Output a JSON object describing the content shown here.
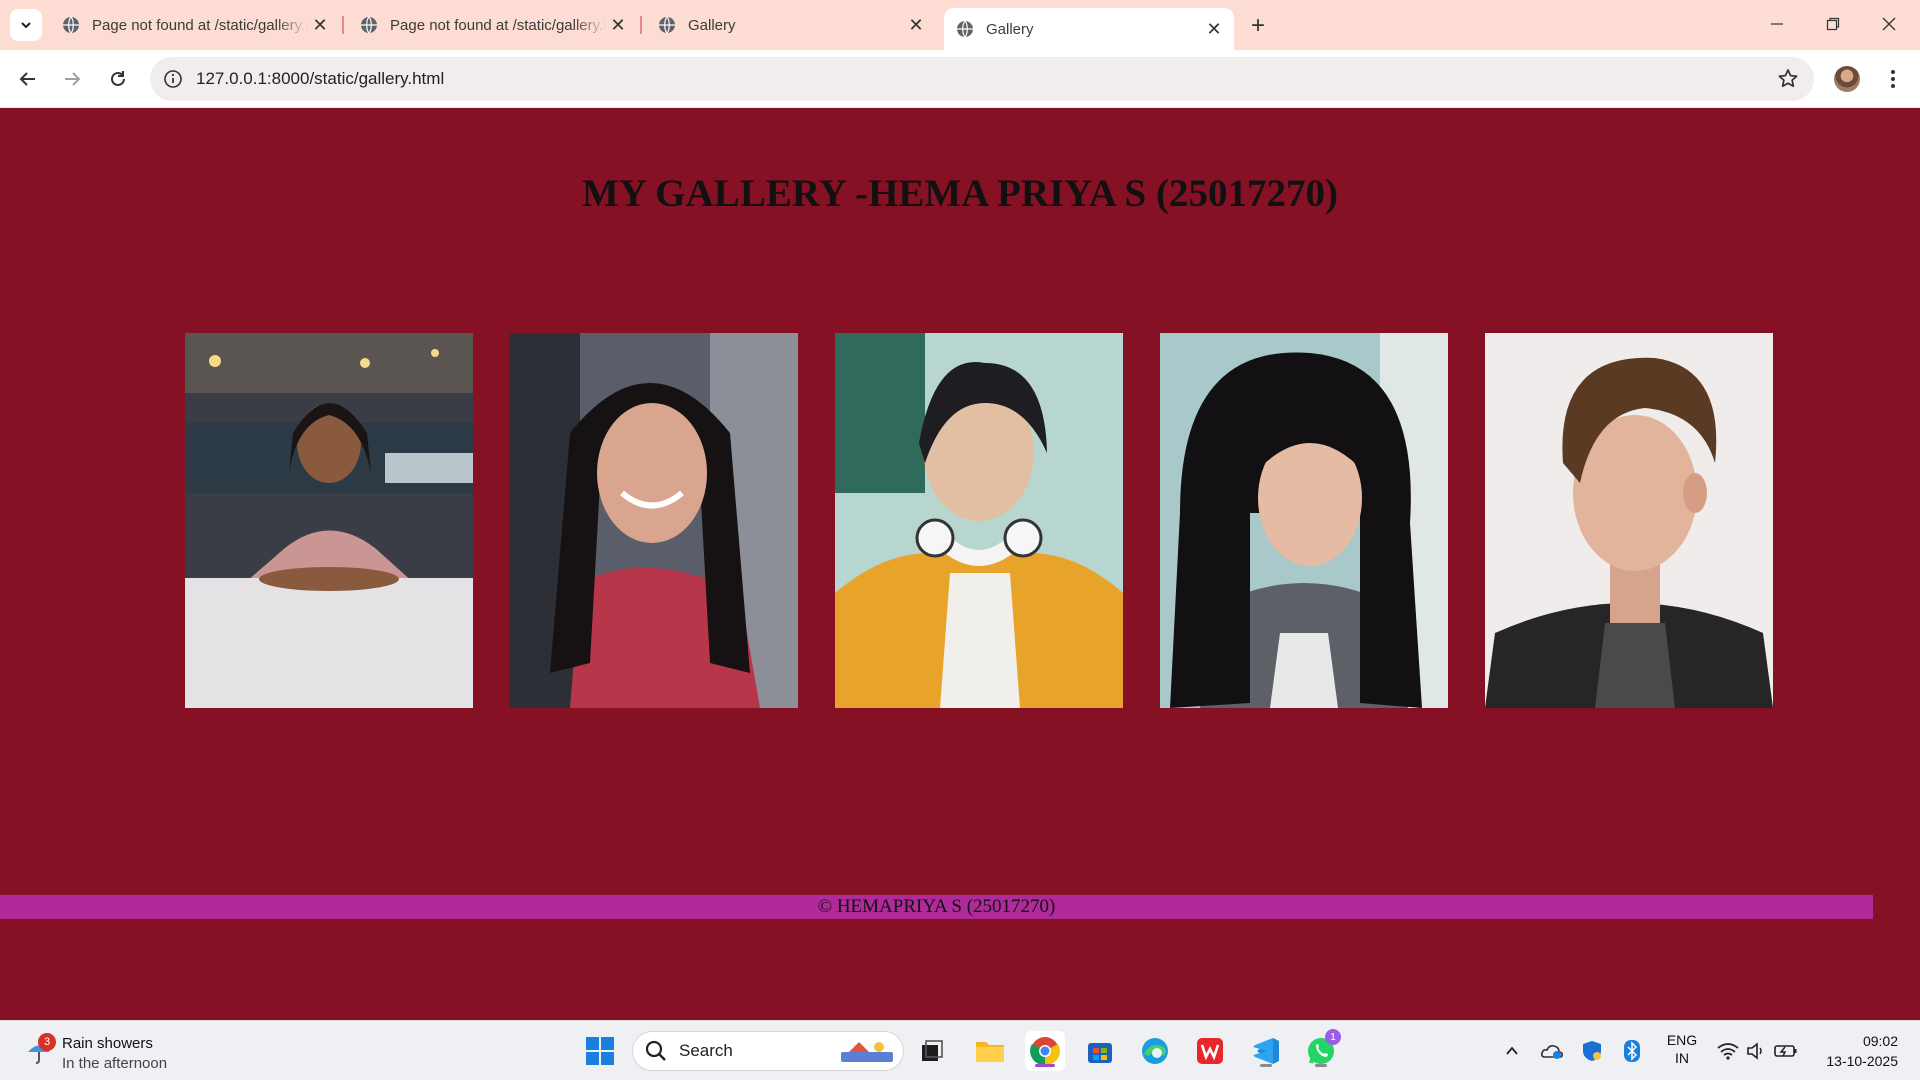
{
  "browser": {
    "tabs": [
      {
        "title": "Page not found at /static/gallery.html",
        "active": false
      },
      {
        "title": "Page not found at /static/gallery.html",
        "active": false
      },
      {
        "title": "Gallery",
        "active": false
      },
      {
        "title": "Gallery",
        "active": true
      }
    ],
    "url": "127.0.0.1:8000/static/gallery.html"
  },
  "page": {
    "heading": "MY GALLERY -HEMA PRIYA S (25017270)",
    "photos": [
      {
        "label": "girl-pink-top-portrait"
      },
      {
        "label": "girl-smiling-selfie"
      },
      {
        "label": "boy-yellow-jacket-headphones"
      },
      {
        "label": "girl-long-hair-portrait"
      },
      {
        "label": "boy-side-profile-portrait"
      }
    ],
    "footer": "© HEMAPRIYA S (25017270)",
    "colors": {
      "background": "#861024",
      "footer": "#b02a9b"
    }
  },
  "taskbar": {
    "weather": {
      "line1": "Rain showers",
      "line2": "In the afternoon",
      "badge": "3"
    },
    "search_label": "Search",
    "whatsapp_badge": "1",
    "lang": {
      "line1": "ENG",
      "line2": "IN"
    },
    "clock": {
      "time": "09:02",
      "date": "13-10-2025"
    }
  }
}
